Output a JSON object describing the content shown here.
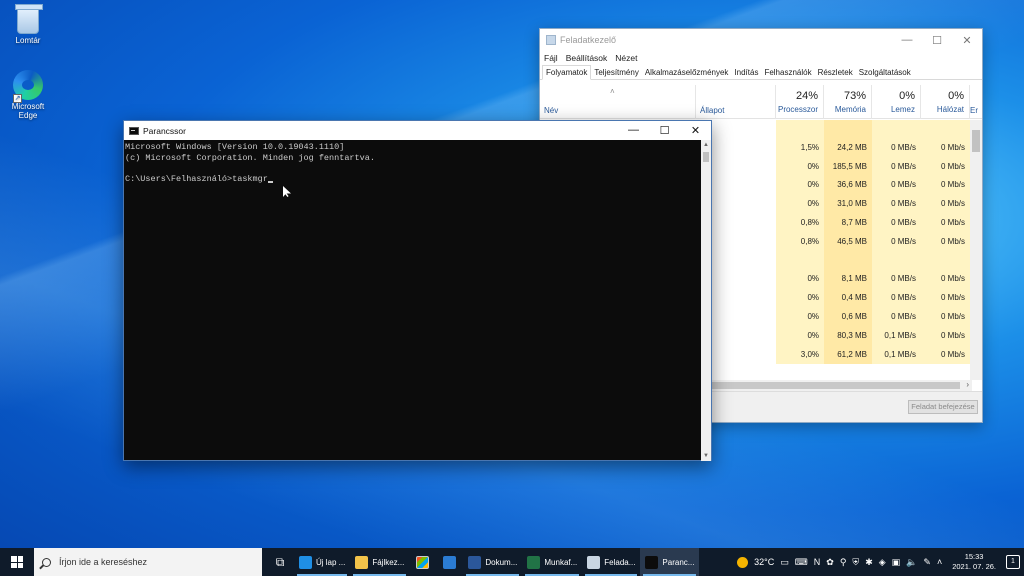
{
  "desktop": {
    "icons": [
      {
        "label": "Lomtár"
      },
      {
        "label": "Microsoft Edge"
      }
    ]
  },
  "task_manager": {
    "title": "Feladatkezelő",
    "menu": [
      "Fájl",
      "Beállítások",
      "Nézet"
    ],
    "tabs": [
      "Folyamatok",
      "Teljesítmény",
      "Alkalmazáselőzmények",
      "Indítás",
      "Felhasználók",
      "Részletek",
      "Szolgáltatások"
    ],
    "active_tab": "Folyamatok",
    "columns": {
      "name": "Név",
      "state": "Állapot",
      "cpu": {
        "pct": "24%",
        "label": "Processzor"
      },
      "mem": {
        "pct": "73%",
        "label": "Memória"
      },
      "disk": {
        "pct": "0%",
        "label": "Lemez"
      },
      "net": {
        "pct": "0%",
        "label": "Hálózat"
      },
      "extra": "Er"
    },
    "rows": [
      {
        "cpu": "",
        "mem": "",
        "disk": "",
        "net": ""
      },
      {
        "cpu": "1,5%",
        "mem": "24,2 MB",
        "disk": "0 MB/s",
        "net": "0 Mb/s"
      },
      {
        "cpu": "0%",
        "mem": "185,5 MB",
        "disk": "0 MB/s",
        "net": "0 Mb/s"
      },
      {
        "cpu": "0%",
        "mem": "36,6 MB",
        "disk": "0 MB/s",
        "net": "0 Mb/s"
      },
      {
        "cpu": "0%",
        "mem": "31,0 MB",
        "disk": "0 MB/s",
        "net": "0 Mb/s"
      },
      {
        "cpu": "0,8%",
        "mem": "8,7 MB",
        "disk": "0 MB/s",
        "net": "0 Mb/s"
      },
      {
        "cpu": "0,8%",
        "mem": "46,5 MB",
        "disk": "0 MB/s",
        "net": "0 Mb/s"
      },
      {
        "cpu": "",
        "mem": "",
        "disk": "",
        "net": ""
      },
      {
        "cpu": "0%",
        "mem": "8,1 MB",
        "disk": "0 MB/s",
        "net": "0 Mb/s"
      },
      {
        "cpu": "0%",
        "mem": "0,4 MB",
        "disk": "0 MB/s",
        "net": "0 Mb/s"
      },
      {
        "cpu": "0%",
        "mem": "0,6 MB",
        "disk": "0 MB/s",
        "net": "0 Mb/s"
      },
      {
        "cpu": "0%",
        "mem": "80,3 MB",
        "disk": "0,1 MB/s",
        "net": "0 Mb/s"
      },
      {
        "cpu": "3,0%",
        "mem": "61,2 MB",
        "disk": "0,1 MB/s",
        "net": "0 Mb/s"
      }
    ],
    "end_task_label": "Feladat befejezése"
  },
  "cmd": {
    "title": "Parancssor",
    "lines": [
      "Microsoft Windows [Version 10.0.19043.1110]",
      "(c) Microsoft Corporation. Minden jog fenntartva.",
      "",
      "C:\\Users\\Felhasználó>taskmgr"
    ]
  },
  "taskbar": {
    "search_placeholder": "Írjon ide a kereséshez",
    "apps": [
      {
        "label": "Új lap ...",
        "icon": "edge-icon",
        "color": "#1f8fe5"
      },
      {
        "label": "Fájlkez...",
        "icon": "folder-icon",
        "color": "#f2c34a"
      },
      {
        "label": "",
        "icon": "store-icon",
        "color": "#ffffff"
      },
      {
        "label": "",
        "icon": "mail-icon",
        "color": "#2b7cd3"
      },
      {
        "label": "Dokum...",
        "icon": "word-icon",
        "color": "#2b579a"
      },
      {
        "label": "Munkaf...",
        "icon": "excel-icon",
        "color": "#217346"
      },
      {
        "label": "Felada...",
        "icon": "task-manager-icon",
        "color": "#c9d6e3"
      },
      {
        "label": "Paranc...",
        "icon": "cmd-icon",
        "color": "#0c0c0c"
      }
    ],
    "weather": "32°C",
    "time": "15:33",
    "date": "2021. 07. 26.",
    "notifications": "1"
  }
}
